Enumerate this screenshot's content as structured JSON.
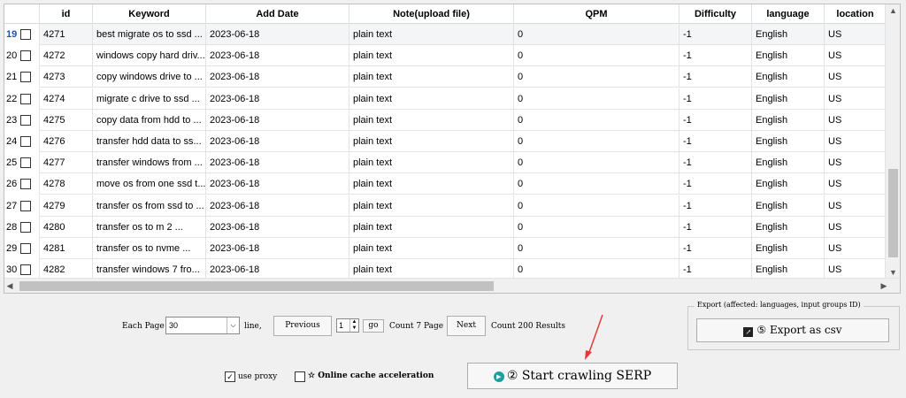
{
  "columns": [
    "id",
    "Keyword",
    "Add Date",
    "Note(upload file)",
    "QPM",
    "Difficulty",
    "language",
    "location"
  ],
  "rows": [
    {
      "num": "19",
      "id": "4271",
      "keyword": "best migrate os to ssd ...",
      "date": "2023-06-18",
      "note": "plain text",
      "qpm": "0",
      "difficulty": "-1",
      "language": "English",
      "location": "US"
    },
    {
      "num": "20",
      "id": "4272",
      "keyword": "windows copy hard driv...",
      "date": "2023-06-18",
      "note": "plain text",
      "qpm": "0",
      "difficulty": "-1",
      "language": "English",
      "location": "US"
    },
    {
      "num": "21",
      "id": "4273",
      "keyword": "copy windows drive to ...",
      "date": "2023-06-18",
      "note": "plain text",
      "qpm": "0",
      "difficulty": "-1",
      "language": "English",
      "location": "US"
    },
    {
      "num": "22",
      "id": "4274",
      "keyword": "migrate c drive to ssd ...",
      "date": "2023-06-18",
      "note": "plain text",
      "qpm": "0",
      "difficulty": "-1",
      "language": "English",
      "location": "US"
    },
    {
      "num": "23",
      "id": "4275",
      "keyword": "copy data from hdd to ...",
      "date": "2023-06-18",
      "note": "plain text",
      "qpm": "0",
      "difficulty": "-1",
      "language": "English",
      "location": "US"
    },
    {
      "num": "24",
      "id": "4276",
      "keyword": "transfer hdd data to ss...",
      "date": "2023-06-18",
      "note": "plain text",
      "qpm": "0",
      "difficulty": "-1",
      "language": "English",
      "location": "US"
    },
    {
      "num": "25",
      "id": "4277",
      "keyword": "transfer windows from ...",
      "date": "2023-06-18",
      "note": "plain text",
      "qpm": "0",
      "difficulty": "-1",
      "language": "English",
      "location": "US"
    },
    {
      "num": "26",
      "id": "4278",
      "keyword": "move os from one ssd t...",
      "date": "2023-06-18",
      "note": "plain text",
      "qpm": "0",
      "difficulty": "-1",
      "language": "English",
      "location": "US"
    },
    {
      "num": "27",
      "id": "4279",
      "keyword": "transfer os from ssd to ...",
      "date": "2023-06-18",
      "note": "plain text",
      "qpm": "0",
      "difficulty": "-1",
      "language": "English",
      "location": "US"
    },
    {
      "num": "28",
      "id": "4280",
      "keyword": "transfer os to m 2 ...",
      "date": "2023-06-18",
      "note": "plain text",
      "qpm": "0",
      "difficulty": "-1",
      "language": "English",
      "location": "US"
    },
    {
      "num": "29",
      "id": "4281",
      "keyword": "transfer os to nvme ...",
      "date": "2023-06-18",
      "note": "plain text",
      "qpm": "0",
      "difficulty": "-1",
      "language": "English",
      "location": "US"
    },
    {
      "num": "30",
      "id": "4282",
      "keyword": "transfer windows 7 fro...",
      "date": "2023-06-18",
      "note": "plain text",
      "qpm": "0",
      "difficulty": "-1",
      "language": "English",
      "location": "US"
    }
  ],
  "pager": {
    "each_page_label": "Each Page",
    "page_size": "30",
    "line_label": "line,",
    "previous": "Previous",
    "current_page": "1",
    "go": "go",
    "count_pages": "Count 7 Page",
    "next": "Next",
    "count_results": "Count 200 Results"
  },
  "export": {
    "legend": "Export (affected: languages, input groups ID)",
    "button": "⑤ Export as csv"
  },
  "options": {
    "use_proxy": "use proxy",
    "online_cache": "Online cache acceleration"
  },
  "start": {
    "button": "② Start crawling SERP"
  },
  "colors": {
    "accent": "#1a56b8",
    "annotation_arrow": "#e53935",
    "start_icon": "#1e9e9e"
  }
}
